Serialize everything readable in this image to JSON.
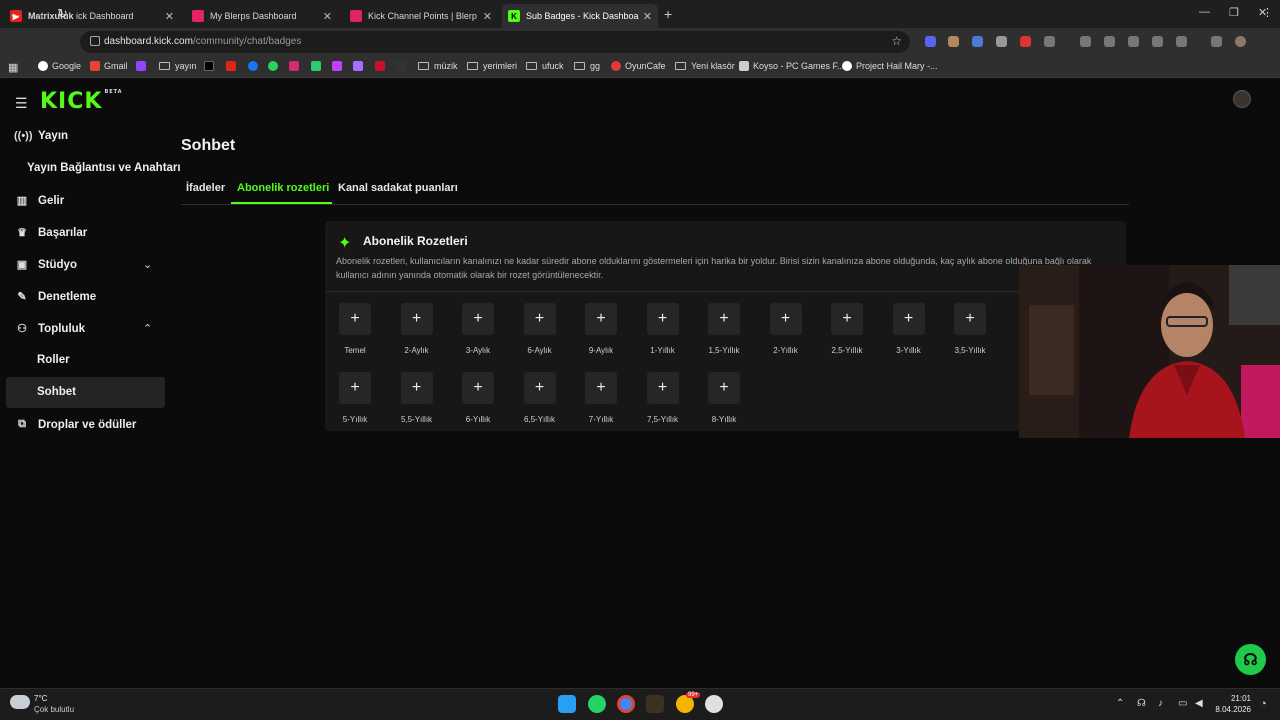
{
  "browser": {
    "tabs": [
      {
        "label": "Matrixufuk",
        "suffix": "ick Dashboard",
        "icon": "youtube-icon",
        "active": false
      },
      {
        "label": "My Blerps Dashboard",
        "icon": "blerp-icon",
        "active": false
      },
      {
        "label": "Kick Channel Points | Blerp",
        "icon": "blerp-icon",
        "active": false
      },
      {
        "label": "Sub Badges - Kick Dashboard",
        "icon": "kick-icon",
        "active": true
      }
    ],
    "url_host": "dashboard.kick.com",
    "url_path": "/community/chat/badges",
    "bookmarks": {
      "google": "Google",
      "gmail": "Gmail",
      "yayin": "yayın",
      "muzik": "müzik",
      "yerimleri": "yerimleri",
      "ufuck": "ufuck",
      "gg": "gg",
      "oyuncafe": "OyunCafe",
      "yeni_klasor": "Yeni klasör",
      "koyso": "Koyso - PC Games F...",
      "project_hail_mary": "Project Hail Mary -..."
    }
  },
  "sidebar": {
    "logo": "KICK",
    "logo_badge": "BETA",
    "items": {
      "yayin": "Yayın",
      "yayin_baglanti": "Yayın Bağlantısı ve Anahtarı",
      "gelir": "Gelir",
      "basarilar": "Başarılar",
      "studyo": "Stüdyo",
      "denetleme": "Denetleme",
      "topluluk": "Topluluk",
      "roller": "Roller",
      "sohbet": "Sohbet",
      "droplar": "Droplar ve ödüller"
    }
  },
  "main": {
    "title": "Sohbet",
    "tabs": {
      "ifadeler": "İfadeler",
      "abonelik": "Abonelik rozetleri",
      "kanal": "Kanal sadakat puanları"
    },
    "card": {
      "title": "Abonelik Rozetleri",
      "description": "Abonelik rozetleri, kullanıcıların kanalınızı ne kadar süredir abone olduklarını göstermeleri için harika bir yoldur. Birisi sizin kanalınıza abone olduğunda, kaç aylık abone olduğuna bağlı olarak kullanıcı adının yanında otomatik olarak bir rozet görüntülenecektir.",
      "add_symbol": "+",
      "badges_row1": [
        "Temel",
        "2-Aylık",
        "3-Aylık",
        "6-Aylık",
        "9-Aylık",
        "1-Yıllık",
        "1,5-Yıllık",
        "2-Yıllık",
        "2,5-Yıllık",
        "3-Yıllık",
        "3,5-Yıllık"
      ],
      "badges_row2": [
        "5-Yıllık",
        "5,5-Yıllık",
        "6-Yıllık",
        "6,5-Yıllık",
        "7-Yıllık",
        "7,5-Yıllık",
        "8-Yıllık"
      ]
    }
  },
  "taskbar": {
    "temperature": "7°C",
    "condition": "Çok bulutlu",
    "time": "21:01",
    "date": "8.04.2026",
    "notification_count": "99+"
  },
  "colors": {
    "accent": "#53fc18",
    "background": "#0b0b0b",
    "card": "#171717"
  }
}
